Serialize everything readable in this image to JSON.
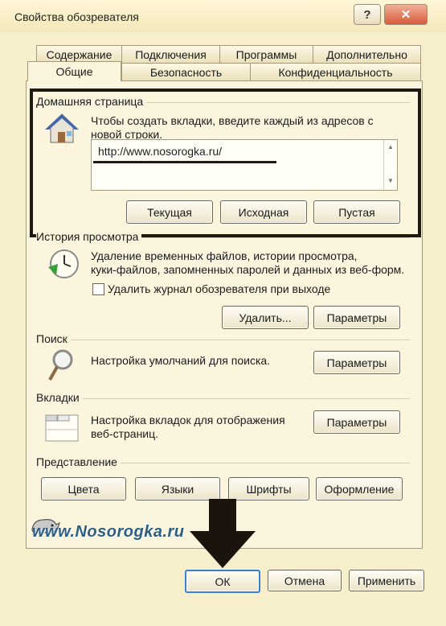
{
  "window": {
    "title": "Свойства обозревателя",
    "help_label": "?",
    "close_label": "✕"
  },
  "tabs": {
    "row1": [
      "Содержание",
      "Подключения",
      "Программы",
      "Дополнительно"
    ],
    "row2": [
      "Общие",
      "Безопасность",
      "Конфиденциальность"
    ],
    "active": "Общие"
  },
  "homepage": {
    "label": "Домашняя страница",
    "hint_line1": "Чтобы создать вкладки, введите каждый из адресов с",
    "hint_line2": "новой строки.",
    "url": "http://www.nosorogka.ru/",
    "btn_current": "Текущая",
    "btn_default": "Исходная",
    "btn_blank": "Пустая"
  },
  "history": {
    "label": "История просмотра",
    "desc_line1": "Удаление временных файлов, истории просмотра,",
    "desc_line2": "куки-файлов, запомненных паролей и данных из веб-форм.",
    "checkbox_label": "Удалить журнал обозревателя при выходе",
    "btn_delete": "Удалить...",
    "btn_settings": "Параметры"
  },
  "search": {
    "label": "Поиск",
    "desc": "Настройка умолчаний для поиска.",
    "btn_settings": "Параметры"
  },
  "tabs_section": {
    "label": "Вкладки",
    "desc_line1": "Настройка вкладок для отображения",
    "desc_line2": "веб-страниц.",
    "btn_settings": "Параметры"
  },
  "appearance": {
    "label": "Представление",
    "btn_colors": "Цвета",
    "btn_languages": "Языки",
    "btn_fonts": "Шрифты",
    "btn_accessibility": "Оформление"
  },
  "watermark": "www.Nosorogka.ru",
  "footer": {
    "ok": "ОК",
    "cancel": "Отмена",
    "apply": "Применить"
  },
  "colors": {
    "annotation": "#1e1a12",
    "background": "#f7efcc",
    "close_button": "#d85a3a"
  }
}
